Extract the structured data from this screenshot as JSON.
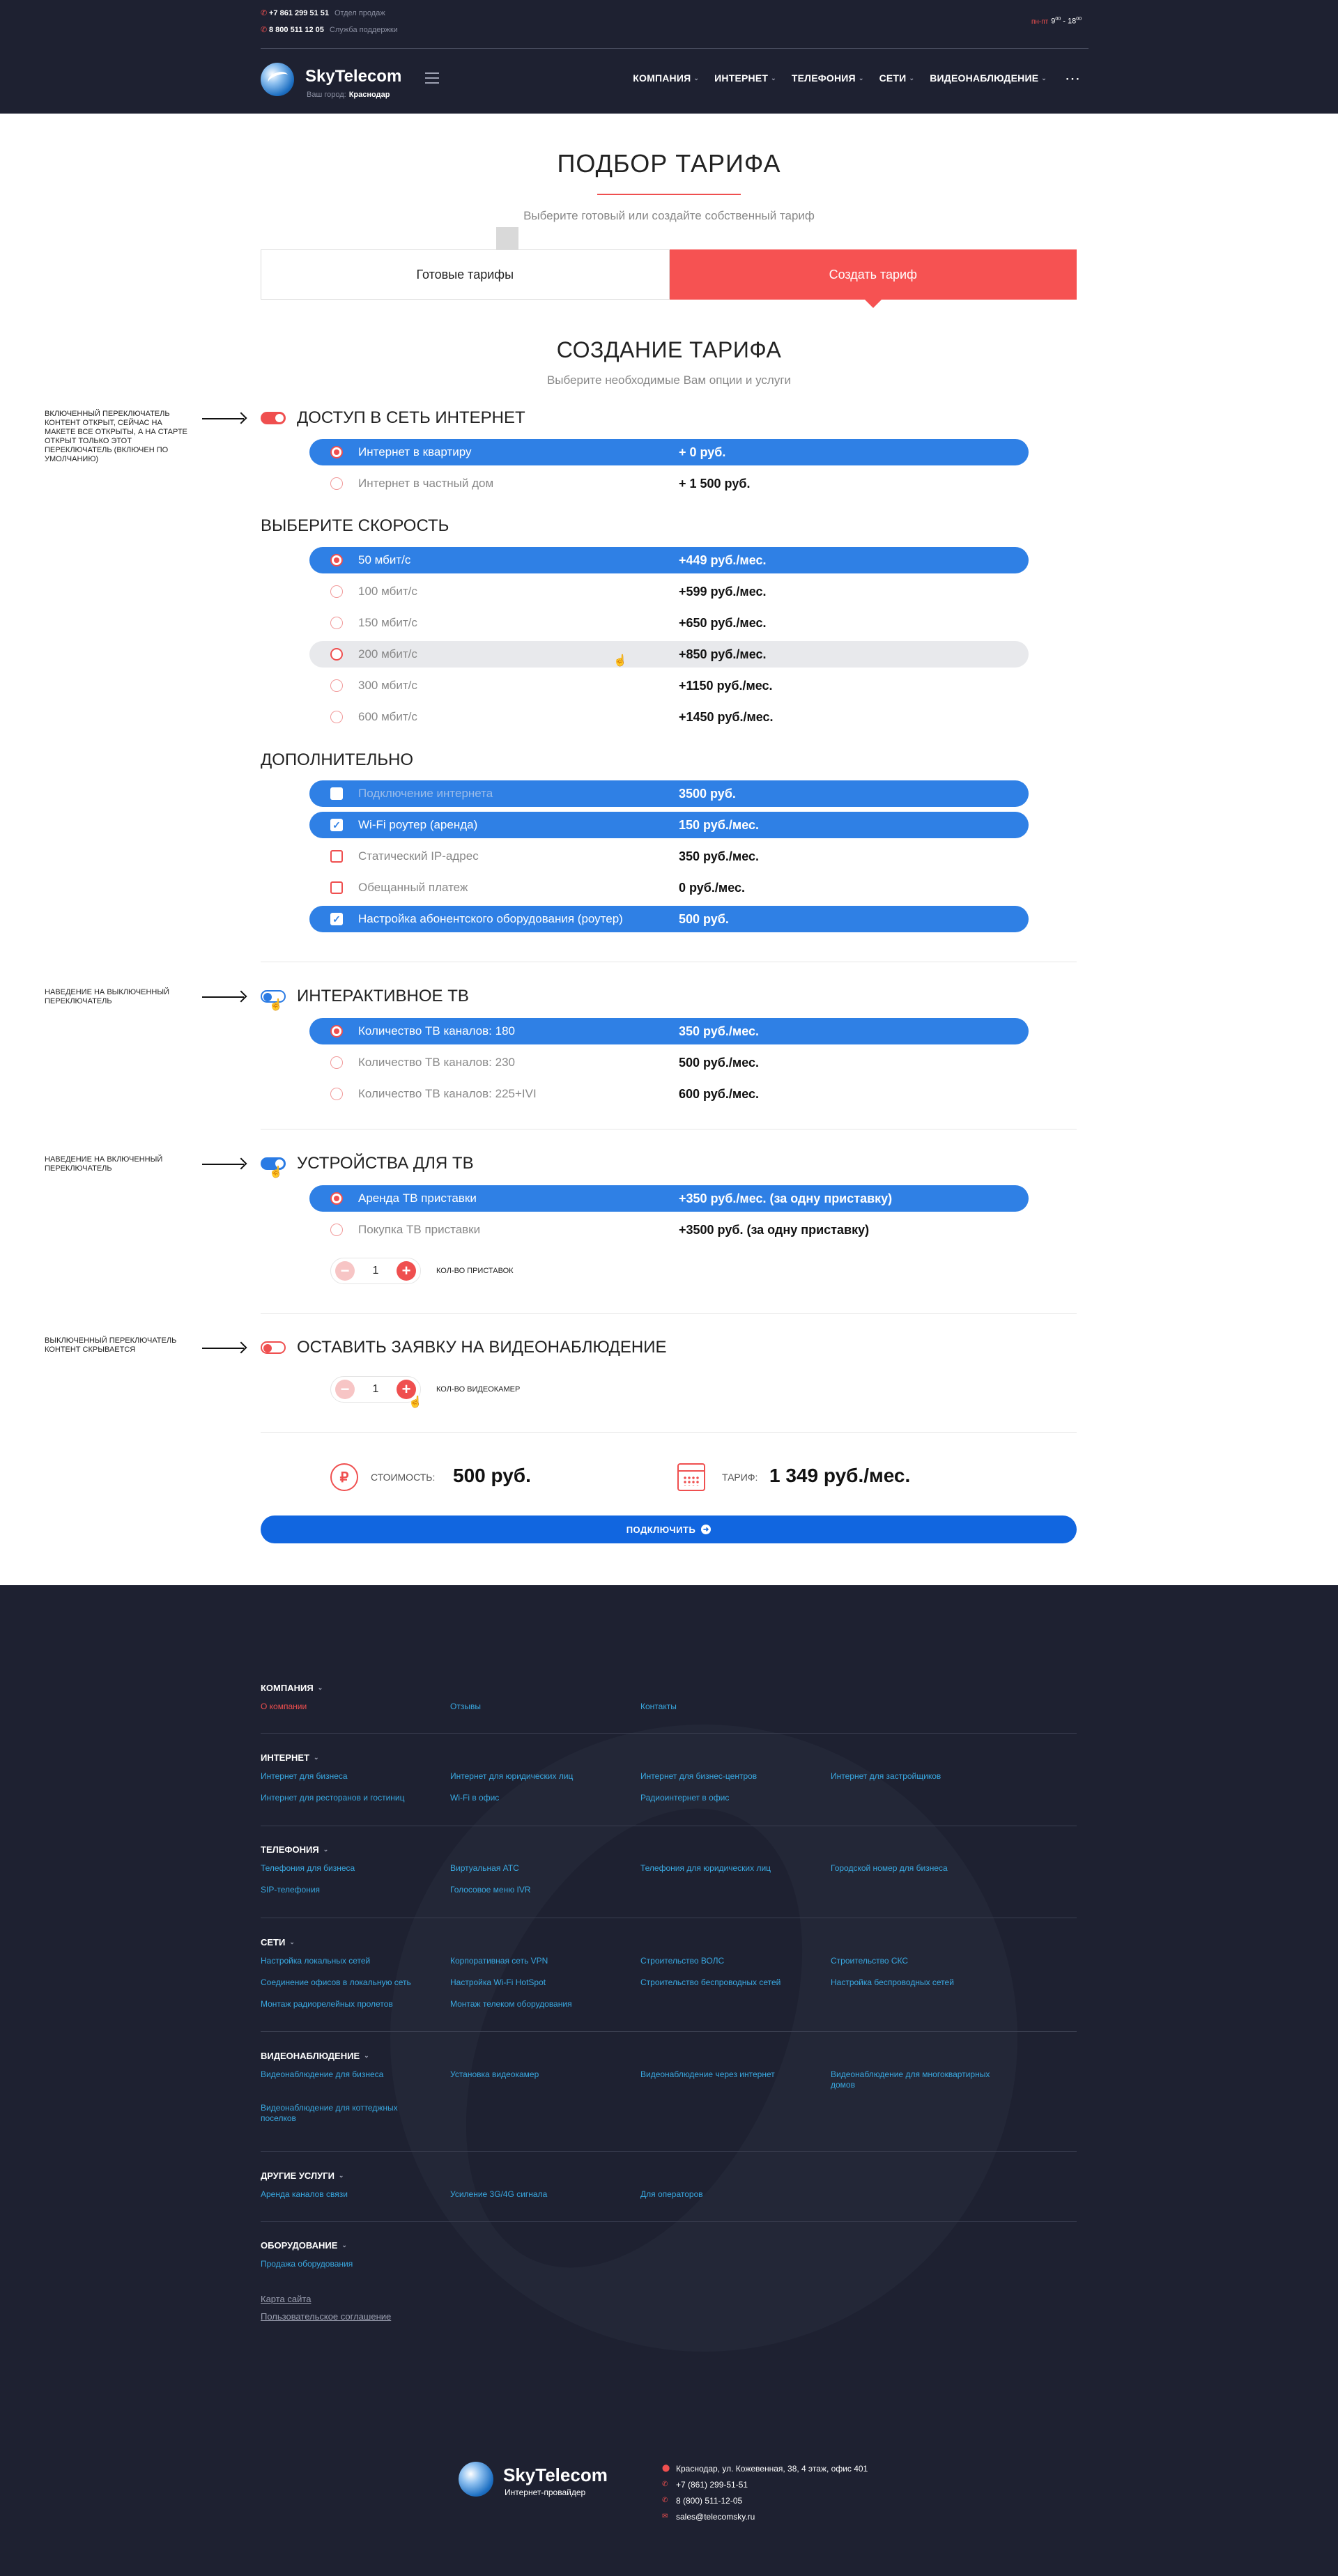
{
  "header": {
    "phones": [
      {
        "number": "+7 861 299 51 51",
        "label": "Отдел продаж"
      },
      {
        "number": "8 800 511 12 05",
        "label": "Служба поддержки"
      }
    ],
    "hours": {
      "days": "пн-пт",
      "from": "9",
      "from_min": "00",
      "to": "18",
      "to_min": "00",
      "sep": " - "
    },
    "brand": "SkyTelecom",
    "city_label": "Ваш город:",
    "city": "Краснодар",
    "menu": [
      "КОМПАНИЯ",
      "ИНТЕРНЕТ",
      "ТЕЛЕФОНИЯ",
      "СЕТИ",
      "ВИДЕОНАБЛЮДЕНИЕ"
    ],
    "more": "⋯"
  },
  "page": {
    "title": "ПОДБОР ТАРИФА",
    "subtitle": "Выберите готовый или создайте собственный тариф",
    "tabs": [
      "Готовые тарифы",
      "Создать тариф"
    ],
    "create_title": "СОЗДАНИЕ ТАРИФА",
    "create_subtitle": "Выберите необходимые Вам опции и услуги"
  },
  "internet": {
    "title": "ДОСТУП В СЕТЬ ИНТЕРНЕТ",
    "options": [
      {
        "label": "Интернет в квартиру",
        "price": "+ 0 руб."
      },
      {
        "label": "Интернет в частный дом",
        "price": "+ 1 500 руб."
      }
    ]
  },
  "speed": {
    "title": "ВЫБЕРИТЕ СКОРОСТЬ",
    "options": [
      {
        "label": "50 мбит/с",
        "price": "+449 руб./мес."
      },
      {
        "label": "100 мбит/с",
        "price": "+599 руб./мес."
      },
      {
        "label": "150 мбит/с",
        "price": "+650 руб./мес."
      },
      {
        "label": "200 мбит/с",
        "price": "+850 руб./мес."
      },
      {
        "label": "300 мбит/с",
        "price": "+1150 руб./мес."
      },
      {
        "label": "600 мбит/с",
        "price": "+1450 руб./мес."
      }
    ]
  },
  "extra": {
    "title": "ДОПОЛНИТЕЛЬНО",
    "options": [
      {
        "label": "Подключение интернета",
        "price": "3500 руб."
      },
      {
        "label": "Wi-Fi роутер (аренда)",
        "price": "150 руб./мес."
      },
      {
        "label": "Статический IP-адрес",
        "price": "350 руб./мес."
      },
      {
        "label": "Обещанный платеж",
        "price": "0 руб./мес."
      },
      {
        "label": "Настройка абонентского оборудования (роутер)",
        "price": "500 руб."
      }
    ]
  },
  "tv": {
    "title": "ИНТЕРАКТИВНОЕ ТВ",
    "options": [
      {
        "label": "Количество ТВ каналов: 180",
        "price": "350 руб./мес."
      },
      {
        "label": "Количество ТВ каналов: 230",
        "price": "500 руб./мес."
      },
      {
        "label": "Количество ТВ каналов: 225+IVI",
        "price": "600 руб./мес."
      }
    ]
  },
  "devices": {
    "title": "УСТРОЙСТВА ДЛЯ ТВ",
    "options": [
      {
        "label": "Аренда ТВ приставки",
        "price": "+350 руб./мес. (за одну приставку)"
      },
      {
        "label": "Покупка ТВ приставки",
        "price": "+3500 руб. (за одну приставку)"
      }
    ],
    "qty": "1",
    "qty_label": "КОЛ-ВО ПРИСТАВОК"
  },
  "video": {
    "title": "ОСТАВИТЬ ЗАЯВКУ НА ВИДЕОНАБЛЮДЕНИЕ",
    "qty": "1",
    "qty_label": "КОЛ-ВО ВИДЕОКАМЕР"
  },
  "notes": [
    "ВКЛЮЧЕННЫЙ ПЕРЕКЛЮЧАТЕЛЬ КОНТЕНТ ОТКРЫТ, СЕЙЧАС НА МАКЕТЕ ВСЕ ОТКРЫТЫ, А НА СТАРТЕ ОТКРЫТ ТОЛЬКО ЭТОТ ПЕРЕКЛЮЧАТЕЛЬ (ВКЛЮЧЕН ПО УМОЛЧАНИЮ)",
    "НАВЕДЕНИЕ НА ВЫКЛЮЧЕННЫЙ ПЕРЕКЛЮЧАТЕЛЬ",
    "НАВЕДЕНИЕ НА ВКЛЮЧЕННЫЙ ПЕРЕКЛЮЧАТЕЛЬ",
    "ВЫКЛЮЧЕННЫЙ ПЕРЕКЛЮЧАТЕЛЬ КОНТЕНТ СКРЫВАЕТСЯ"
  ],
  "summary": {
    "cost_label": "СТОИМОСТЬ:",
    "cost_value": "500 руб.",
    "tariff_label": "ТАРИФ:",
    "tariff_value": "1 349 руб./мес.",
    "rub_symbol": "₽"
  },
  "connect_label": "ПОДКЛЮЧИТЬ",
  "footer": {
    "groups": [
      {
        "title": "КОМПАНИЯ",
        "links": [
          "О компании",
          "Отзывы",
          "Контакты"
        ]
      },
      {
        "title": "ИНТЕРНЕТ",
        "links": [
          "Интернет для бизнеса",
          "Интернет для юридических лиц",
          "Интернет для бизнес-центров",
          "Интернет для застройщиков",
          "Интернет для ресторанов и гостиниц",
          "Wi-Fi в офис",
          "Радиоинтернет в офис"
        ]
      },
      {
        "title": "ТЕЛЕФОНИЯ",
        "links": [
          "Телефония для бизнеса",
          "Виртуальная АТС",
          "Телефония для юридических лиц",
          "Городской номер для бизнеса",
          "SIP-телефония",
          "Голосовое меню IVR"
        ]
      },
      {
        "title": "СЕТИ",
        "links": [
          "Настройка локальных сетей",
          "Корпоративная сеть VPN",
          "Строительство ВОЛС",
          "Строительство СКС",
          "Соединение офисов в локальную сеть",
          "Настройка Wi-Fi HotSpot",
          "Строительство беспроводных сетей",
          "Настройка беспроводных сетей",
          "Монтаж радиорелейных пролетов",
          "Монтаж телеком оборудования"
        ]
      },
      {
        "title": "ВИДЕОНАБЛЮДЕНИЕ",
        "links": [
          "Видеонаблюдение для бизнеса",
          "Установка видеокамер",
          "Видеонаблюдение через интернет",
          "Видеонаблюдение для многоквартирных домов",
          "Видеонаблюдение для коттеджных поселков"
        ]
      },
      {
        "title": "ДРУГИЕ УСЛУГИ",
        "links": [
          "Аренда каналов связи",
          "Усиление 3G/4G сигнала",
          "Для операторов"
        ]
      },
      {
        "title": "ОБОРУДОВАНИЕ",
        "links": [
          "Продажа оборудования"
        ]
      }
    ],
    "sitemap": "Карта сайта",
    "agreement": "Пользовательское соглашение",
    "brand": "SkyTelecom",
    "tagline": "Интернет-провайдер",
    "contacts": [
      {
        "icon": "location-icon",
        "text": "Краснодар, ул. Кожевенная, 38, 4 этаж, офис 401"
      },
      {
        "icon": "phone-icon",
        "text": "+7 (861) 299-51-51"
      },
      {
        "icon": "phone-icon",
        "text": "8 (800) 511-12-05"
      },
      {
        "icon": "mail-icon",
        "text": "sales@telecomsky.ru"
      }
    ]
  },
  "colors": {
    "dark": "#1e2131",
    "accent_red": "#ef4f4f",
    "accent_blue": "#2f80e5",
    "link_blue": "#39a8e0"
  }
}
